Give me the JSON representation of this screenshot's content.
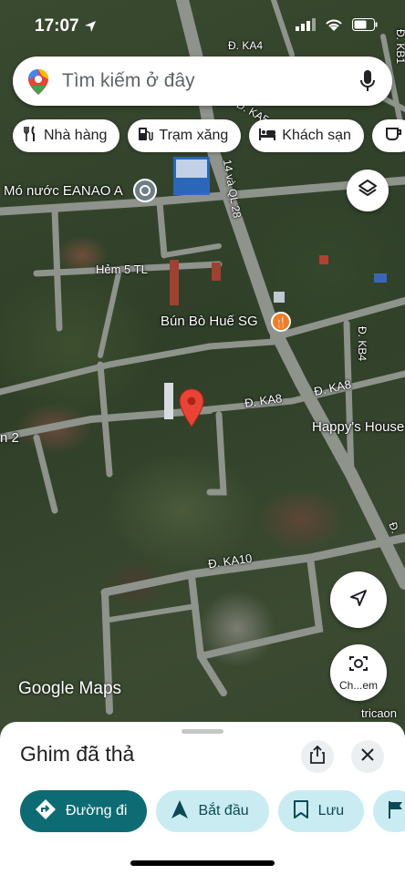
{
  "status_bar": {
    "time": "17:07"
  },
  "search": {
    "placeholder": "Tìm kiếm ở đây"
  },
  "chips": [
    {
      "label": "Nhà hàng",
      "icon": "restaurant-icon"
    },
    {
      "label": "Trạm xăng",
      "icon": "gas-station-icon"
    },
    {
      "label": "Khách sạn",
      "icon": "hotel-icon"
    }
  ],
  "map": {
    "labels": {
      "place_water": "Mó nước EANAO A",
      "hem5": "Hẻm 5 TL",
      "bun_bo": "Bún Bò Huế SG",
      "ka4": "Đ. KA4",
      "ka5": "Đ. KA5",
      "kb1": "Đ. KB1",
      "kb4": "Đ. KB4",
      "ka8a": "Đ. KA8",
      "ka8b": "Đ. KA8",
      "ka10": "Đ. KA10",
      "ql": "14 và QL 28",
      "happy": "Happy's House",
      "n2": "n 2",
      "d_right": "Đ.",
      "tricao": "tricaon"
    },
    "watermark": "Google Maps",
    "camera_label": "Ch...em"
  },
  "sheet": {
    "title": "Ghim đã thả",
    "actions": [
      {
        "label": "Đường đi"
      },
      {
        "label": "Bắt đầu"
      },
      {
        "label": "Lưu"
      }
    ]
  },
  "colors": {
    "primary": "#0d6b73",
    "secondary": "#c9ecf2",
    "pin": "#ea4335"
  }
}
